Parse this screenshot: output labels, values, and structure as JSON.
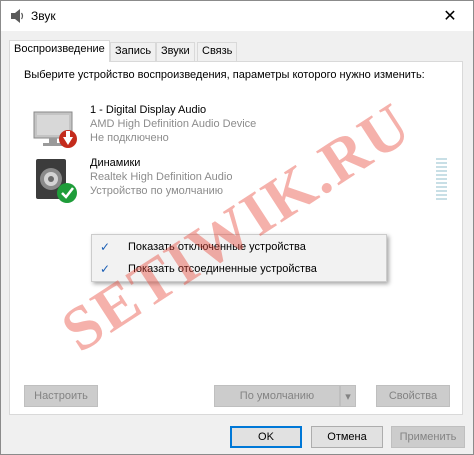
{
  "window": {
    "title": "Звук",
    "close_glyph": "✕"
  },
  "tabs": [
    {
      "label": "Воспроизведение",
      "active": true
    },
    {
      "label": "Запись",
      "active": false
    },
    {
      "label": "Звуки",
      "active": false
    },
    {
      "label": "Связь",
      "active": false
    }
  ],
  "panel": {
    "description": "Выберите устройство воспроизведения, параметры которого нужно изменить:"
  },
  "devices": [
    {
      "name": "1 - Digital Display Audio",
      "driver": "AMD High Definition Audio Device",
      "status": "Не подключено",
      "icon": "monitor-icon",
      "badge": "red-down-arrow-badge"
    },
    {
      "name": "Динамики",
      "driver": "Realtek High Definition Audio",
      "status": "Устройство по умолчанию",
      "icon": "speaker-icon",
      "badge": "green-checkmark-badge"
    }
  ],
  "context_menu": {
    "items": [
      {
        "label": "Показать отключенные устройства",
        "checked": true
      },
      {
        "label": "Показать отсоединенные устройства",
        "checked": true
      }
    ],
    "check_glyph": "✓"
  },
  "panel_buttons": {
    "configure": "Настроить",
    "set_default": "По умолчанию",
    "dropdown_glyph": "▾",
    "properties": "Свойства"
  },
  "footer_buttons": {
    "ok": "OK",
    "cancel": "Отмена",
    "apply": "Применить"
  },
  "watermark": "SETIWIK.RU",
  "colors": {
    "accent": "#0078d7",
    "watermark": "#e64637",
    "badge_green": "#1f9d3a",
    "badge_red": "#c42b1c"
  }
}
